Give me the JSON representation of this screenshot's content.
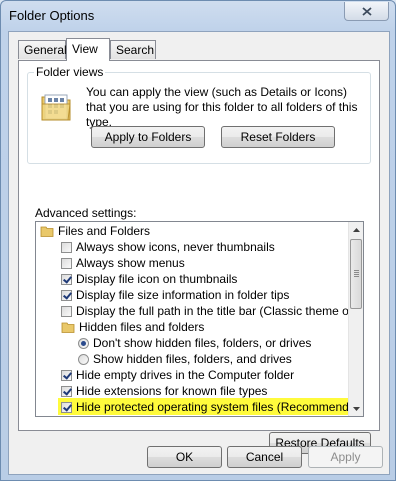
{
  "window": {
    "title": "Folder Options",
    "close_label": "close"
  },
  "tabs": [
    {
      "label": "General",
      "active": false
    },
    {
      "label": "View",
      "active": true
    },
    {
      "label": "Search",
      "active": false
    }
  ],
  "folder_views": {
    "title": "Folder views",
    "description": "You can apply the view (such as Details or Icons) that you are using for this folder to all folders of this type.",
    "apply_label": "Apply to Folders",
    "reset_label": "Reset Folders"
  },
  "advanced": {
    "label": "Advanced settings:",
    "items": [
      {
        "kind": "folder",
        "label": "Files and Folders",
        "level": 0
      },
      {
        "kind": "checkbox",
        "label": "Always show icons, never thumbnails",
        "checked": false,
        "level": 1
      },
      {
        "kind": "checkbox",
        "label": "Always show menus",
        "checked": false,
        "level": 1
      },
      {
        "kind": "checkbox",
        "label": "Display file icon on thumbnails",
        "checked": true,
        "level": 1
      },
      {
        "kind": "checkbox",
        "label": "Display file size information in folder tips",
        "checked": true,
        "level": 1
      },
      {
        "kind": "checkbox",
        "label": "Display the full path in the title bar (Classic theme only)",
        "checked": false,
        "level": 1
      },
      {
        "kind": "folder",
        "label": "Hidden files and folders",
        "level": 1
      },
      {
        "kind": "radio",
        "label": "Don't show hidden files, folders, or drives",
        "checked": true,
        "level": 2
      },
      {
        "kind": "radio",
        "label": "Show hidden files, folders, and drives",
        "checked": false,
        "level": 2
      },
      {
        "kind": "checkbox",
        "label": "Hide empty drives in the Computer folder",
        "checked": true,
        "level": 1
      },
      {
        "kind": "checkbox",
        "label": "Hide extensions for known file types",
        "checked": true,
        "level": 1
      },
      {
        "kind": "checkbox",
        "label": "Hide protected operating system files (Recommended)",
        "checked": true,
        "level": 1,
        "highlighted": true
      }
    ],
    "highlight_color": "#fffb3c"
  },
  "restore_label": "Restore Defaults",
  "footer": {
    "ok_label": "OK",
    "cancel_label": "Cancel",
    "apply_label": "Apply"
  }
}
